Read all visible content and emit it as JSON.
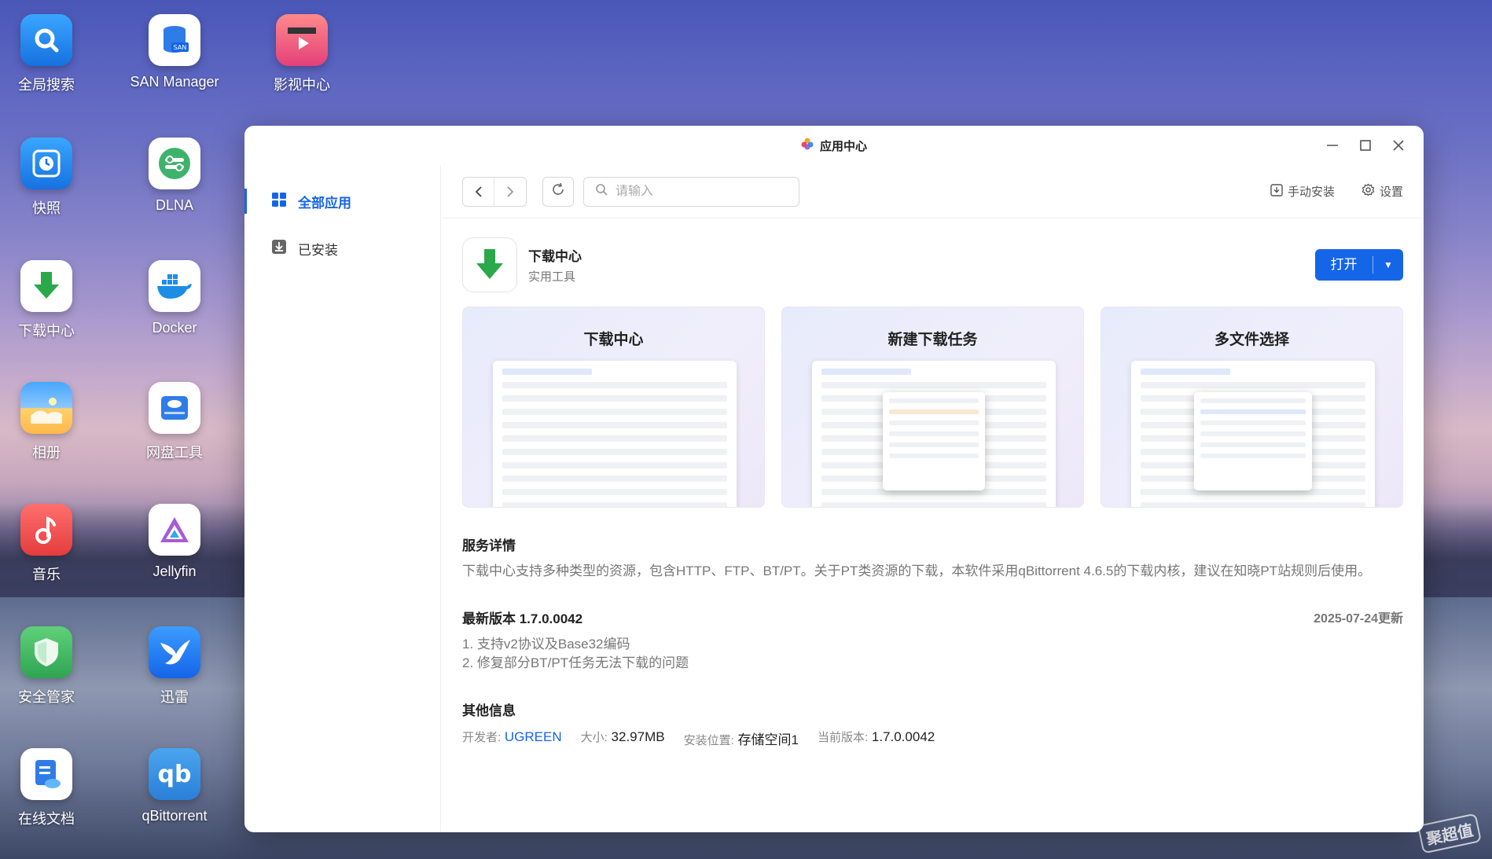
{
  "desktop": {
    "icons": [
      {
        "label": "全局搜索"
      },
      {
        "label": "SAN Manager"
      },
      {
        "label": "影视中心"
      },
      {
        "label": "快照"
      },
      {
        "label": "DLNA"
      },
      {
        "label": "下载中心"
      },
      {
        "label": "Docker"
      },
      {
        "label": "相册"
      },
      {
        "label": "网盘工具"
      },
      {
        "label": "音乐"
      },
      {
        "label": "Jellyfin"
      },
      {
        "label": "安全管家"
      },
      {
        "label": "迅雷"
      },
      {
        "label": "在线文档"
      },
      {
        "label": "qBittorrent"
      }
    ],
    "watermark": "聚超值"
  },
  "window": {
    "title": "应用中心"
  },
  "sidebar": {
    "items": [
      {
        "label": "全部应用"
      },
      {
        "label": "已安装"
      }
    ]
  },
  "toolbar": {
    "search_placeholder": "请输入",
    "manual_install": "手动安装",
    "settings": "设置"
  },
  "app": {
    "name": "下载中心",
    "category": "实用工具",
    "open_label": "打开",
    "screenshots": [
      {
        "title": "下载中心"
      },
      {
        "title": "新建下载任务"
      },
      {
        "title": "多文件选择"
      }
    ],
    "service": {
      "title": "服务详情",
      "text": "下载中心支持多种类型的资源，包含HTTP、FTP、BT/PT。关于PT类资源的下载，本软件采用qBittorrent 4.6.5的下载内核，建议在知晓PT站规则后使用。"
    },
    "version": {
      "title": "最新版本 1.7.0.0042",
      "date": "2025-07-24更新",
      "notes": [
        "1. 支持v2协议及Base32编码",
        "2. 修复部分BT/PT任务无法下载的问题"
      ]
    },
    "other": {
      "title": "其他信息",
      "developer_key": "开发者:",
      "developer": "UGREEN",
      "size_key": "大小:",
      "size": "32.97MB",
      "location_key": "安装位置:",
      "location": "存储空间1",
      "current_key": "当前版本:",
      "current": "1.7.0.0042"
    }
  },
  "colors": {
    "accent": "#1565e8"
  }
}
